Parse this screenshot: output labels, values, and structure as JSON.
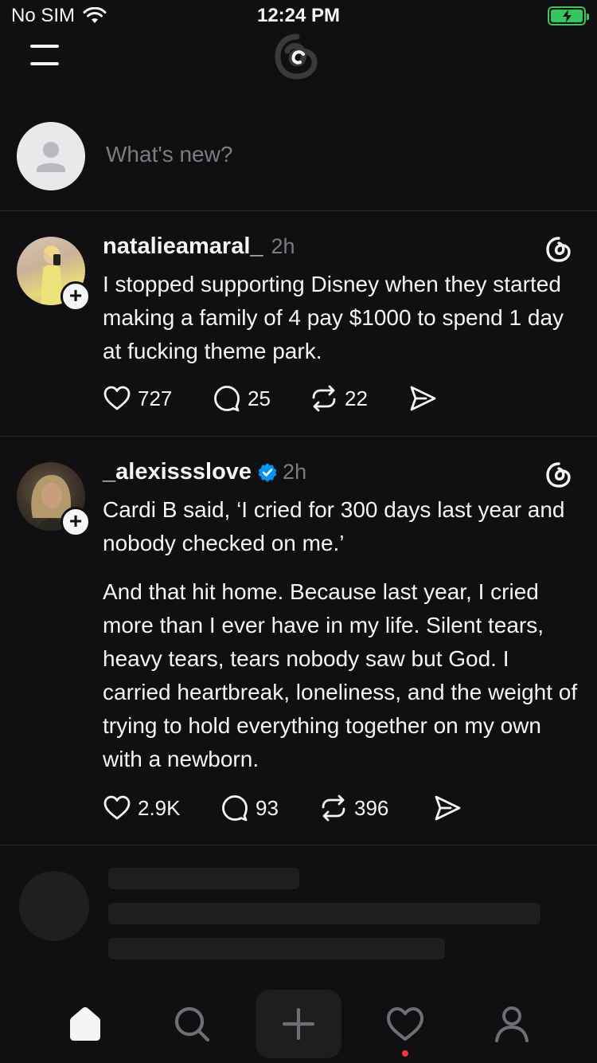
{
  "status_bar": {
    "carrier": "No SIM",
    "time": "12:24 PM"
  },
  "composer": {
    "placeholder": "What's new?"
  },
  "posts": [
    {
      "username": "natalieamaral_",
      "verified": false,
      "time": "2h",
      "paragraphs": [
        "I stopped supporting Disney when they started making a family of 4 pay $1000 to spend 1 day at fucking theme park."
      ],
      "likes": "727",
      "replies": "25",
      "reposts": "22"
    },
    {
      "username": "_alexissslove",
      "verified": true,
      "time": "2h",
      "paragraphs": [
        "Cardi B said, ‘I cried for 300 days last year and nobody checked on me.’",
        "And that hit home. Because last year, I cried more than I ever have in my life. Silent tears, heavy tears, tears nobody saw but God. I carried heartbreak, loneliness, and the weight of trying to hold everything together on my own with a newborn."
      ],
      "likes": "2.9K",
      "replies": "93",
      "reposts": "396"
    }
  ],
  "tab_bar": {
    "items": [
      "home-icon",
      "search-icon",
      "plus-icon",
      "heart-icon",
      "profile-icon"
    ],
    "active": "home-icon",
    "notification_dot_color": "#ff3040"
  },
  "colors": {
    "background": "#101012",
    "text": "#f3f5f7",
    "secondary_text": "#7b7c80",
    "verified": "#0095f6",
    "battery": "#34c759"
  }
}
